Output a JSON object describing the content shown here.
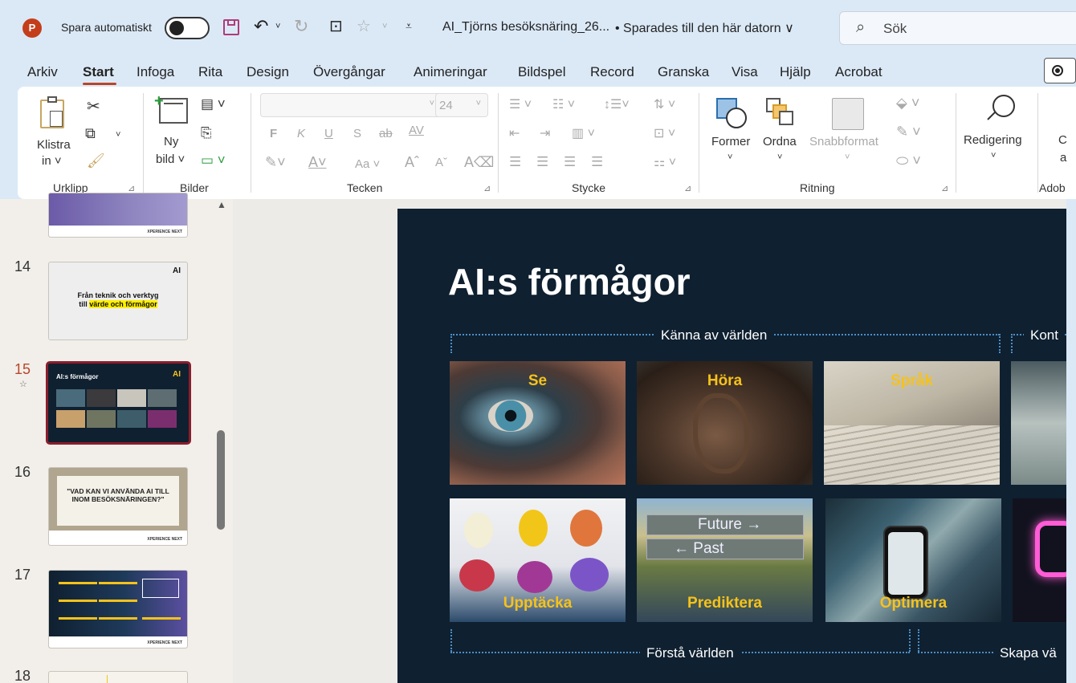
{
  "titlebar": {
    "autosave_label": "Spara automatiskt",
    "doc_title": "AI_Tjörns besöksnäring_26...",
    "save_state": "• Sparades till den här datorn ∨",
    "search_placeholder": "Sök",
    "toggle_state": "off"
  },
  "menu": {
    "items": [
      "Arkiv",
      "Start",
      "Infoga",
      "Rita",
      "Design",
      "Övergångar",
      "Animeringar",
      "Bildspel",
      "Record",
      "Granska",
      "Visa",
      "Hjälp",
      "Acrobat"
    ],
    "active": "Start"
  },
  "ribbon": {
    "groups": {
      "clipboard": "Urklipp",
      "slides": "Bilder",
      "font": "Tecken",
      "paragraph": "Stycke",
      "drawing": "Ritning",
      "adobe": "Adob"
    },
    "paste_label": "Klistra",
    "paste_label2": "in ˅",
    "newslide_label": "Ny",
    "newslide_label2": "bild ˅",
    "font_size": "24",
    "font_buttons": [
      "F",
      "K",
      "U",
      "S",
      "ab",
      "AV"
    ],
    "aa_label": "Aa ˅",
    "shapes_label": "Former",
    "arrange_label": "Ordna",
    "quickstyle_label": "Snabbformat",
    "editing_label": "Redigering",
    "cut_off_label": "C",
    "cut_off_label2": "a"
  },
  "thumbnails": {
    "items": [
      {
        "num": "14",
        "title_a": "Från teknik och verktyg",
        "title_b": "till ",
        "highlight": "värde och förmågor",
        "badge": "AI"
      },
      {
        "num": "15",
        "title": "AI:s förmågor",
        "badge": "AI",
        "star": "☆"
      },
      {
        "num": "16",
        "quote": "\"VAD KAN VI ANVÄNDA AI TILL INOM BESÖKSNÄRINGEN?\"",
        "footer": "XPERIENCE NEXT"
      },
      {
        "num": "17",
        "footer": "XPERIENCE NEXT"
      },
      {
        "num": "18"
      }
    ],
    "top_footer": "XPERIENCE NEXT"
  },
  "slide": {
    "title": "AI:s förmågor",
    "section_top_left": "Känna av världen",
    "section_top_right": "Kont",
    "section_bottom_left": "Förstå världen",
    "section_bottom_right": "Skapa vä",
    "tiles_top": [
      "Se",
      "Höra",
      "Språk"
    ],
    "tiles_bottom": [
      "Upptäcka",
      "Prediktera",
      "Optimera"
    ],
    "sign_future": "Future →",
    "sign_past": "← Past"
  },
  "colors": {
    "accent": "#b7472a",
    "slide_bg": "#0f2030",
    "tile_label": "#f6c21a",
    "dotted_line": "#4a8fc8"
  }
}
